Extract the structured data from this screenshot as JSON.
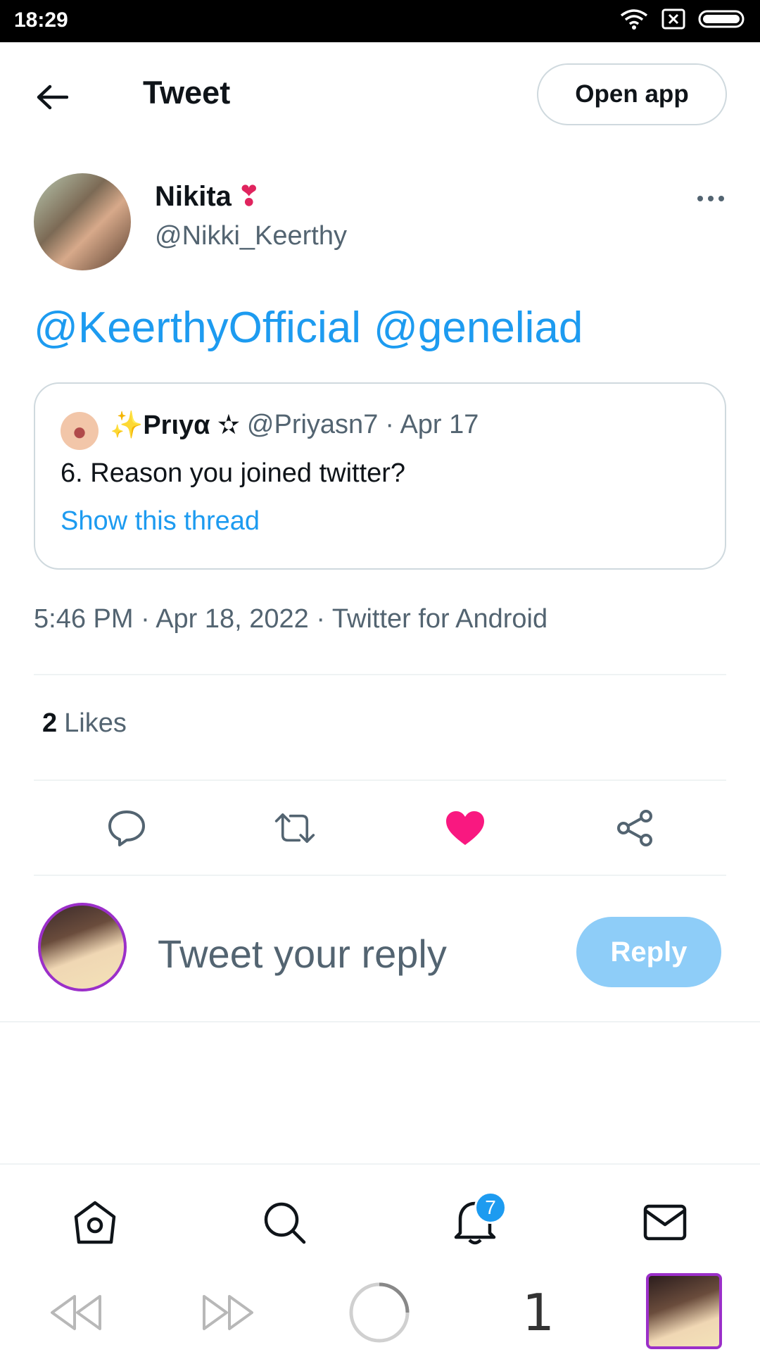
{
  "status_bar": {
    "time": "18:29"
  },
  "header": {
    "title": "Tweet",
    "open_app_label": "Open app"
  },
  "tweet": {
    "author_name": "Nikita",
    "author_emoji": "❣",
    "author_handle": "@Nikki_Keerthy",
    "mentions": [
      "@KeerthyOfficial",
      "@geneliad"
    ],
    "quoted": {
      "name": "✨Prιyα ✫",
      "handle": "@Priyasn7",
      "date": "· Apr 17",
      "text": "6. Reason you joined twitter?",
      "link": "Show this thread"
    },
    "meta": "5:46 PM · Apr 18, 2022 · Twitter for Android",
    "likes_count": "2",
    "likes_label": "Likes"
  },
  "reply_bar": {
    "placeholder": "Tweet your reply",
    "button": "Reply"
  },
  "bottom_nav": {
    "notifications_badge": "7"
  },
  "browser": {
    "tab_count": "1"
  },
  "colors": {
    "accent": "#1d9bf0",
    "like": "#f91880",
    "reply_btn": "#8ecdf8"
  }
}
